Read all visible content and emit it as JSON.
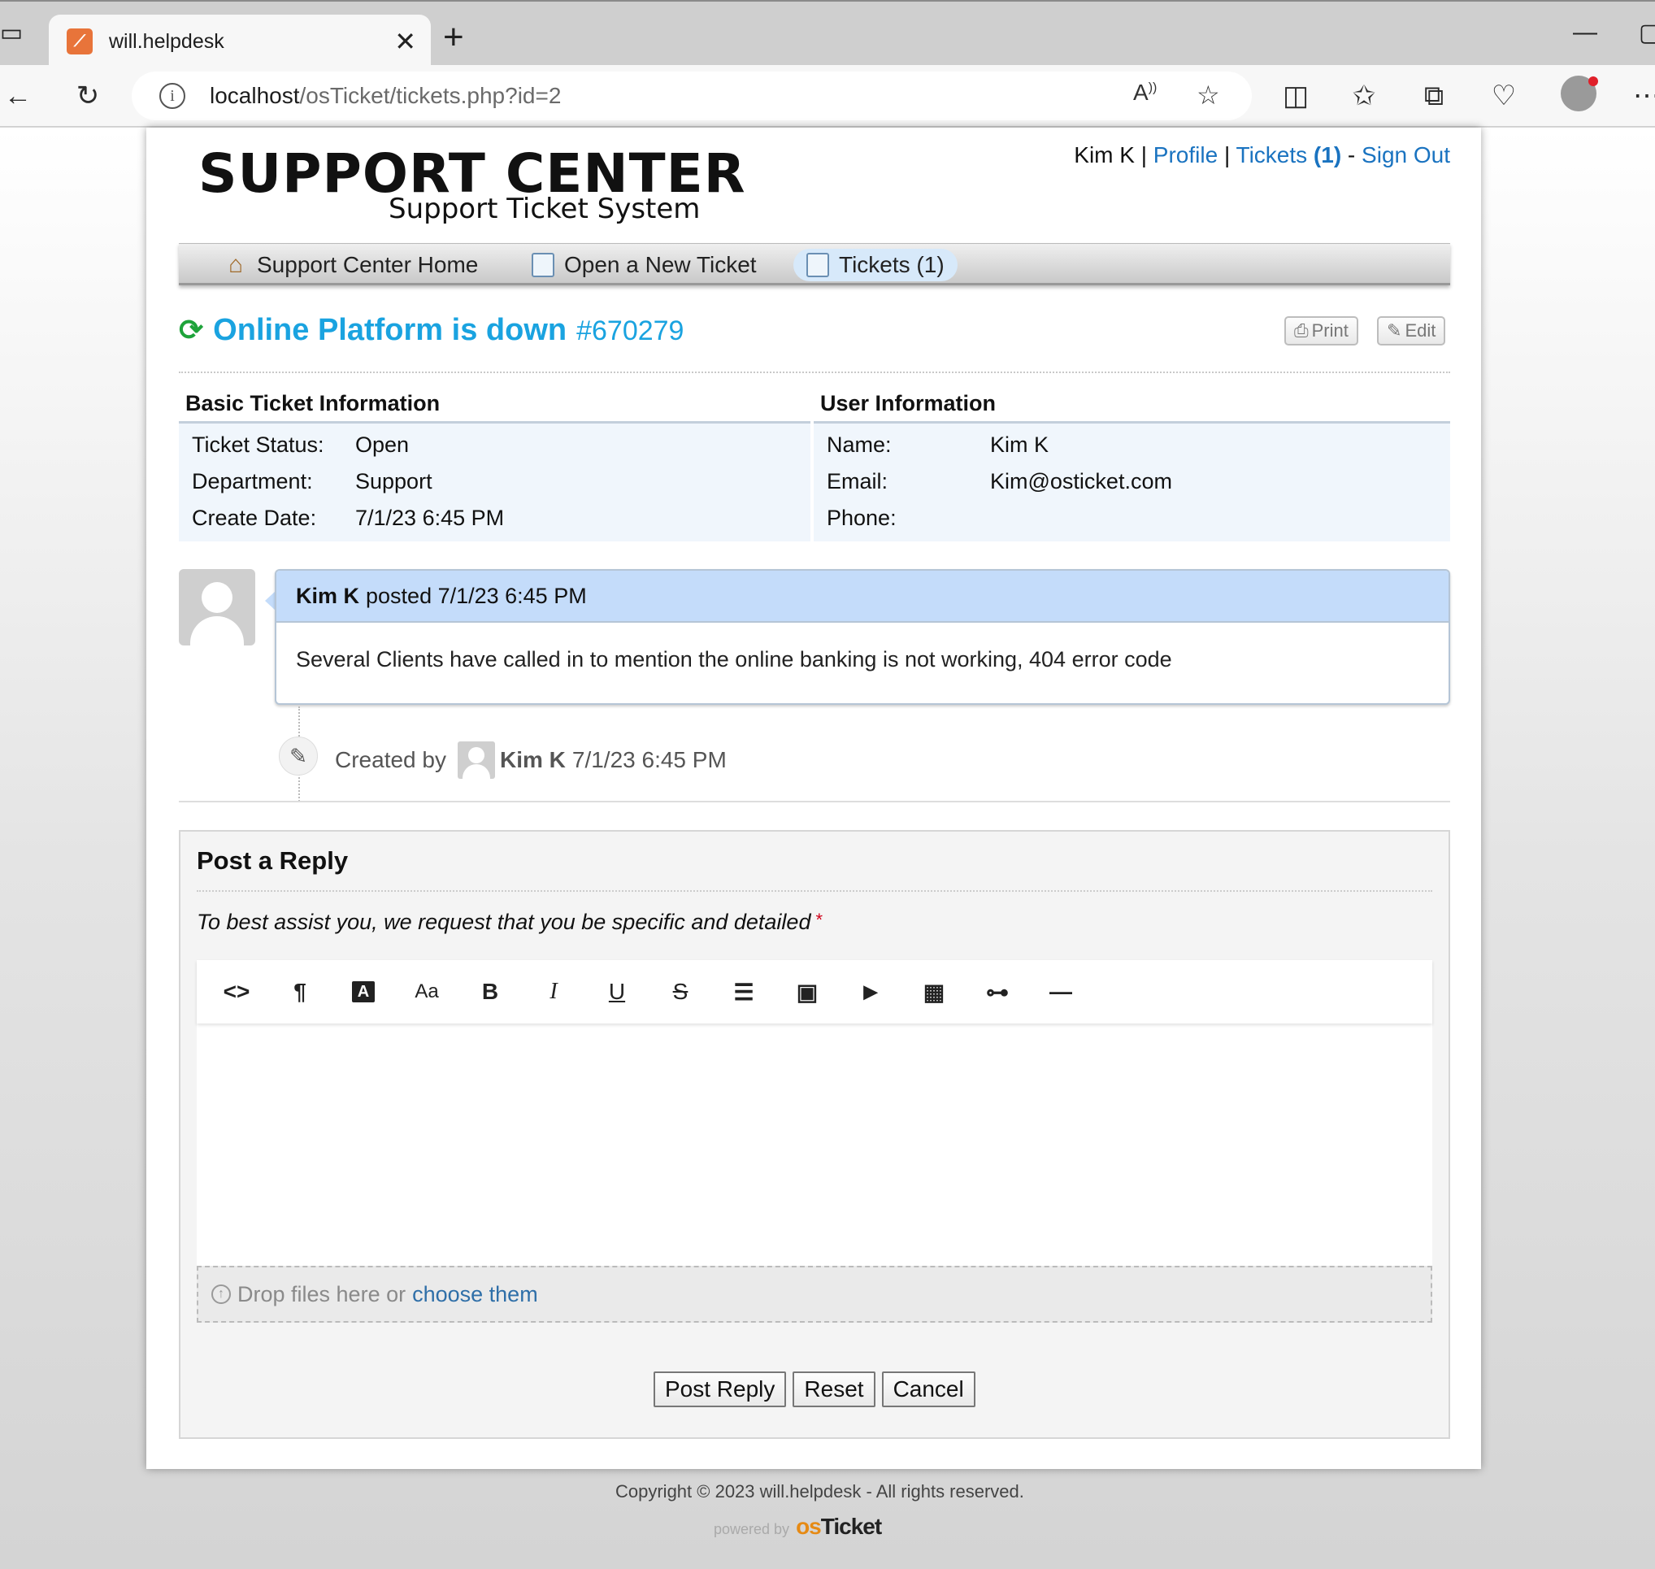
{
  "browser": {
    "tab_title": "will.helpdesk",
    "url_host": "localhost",
    "url_path": "/osTicket/tickets.php?id=2"
  },
  "header": {
    "logo_title": "SUPPORT CENTER",
    "logo_subtitle": "Support Ticket System",
    "user_name": "Kim K",
    "sep1": " | ",
    "profile_link": "Profile",
    "sep2": " | ",
    "tickets_link": "Tickets",
    "tickets_count": "(1)",
    "sep3": " - ",
    "signout_link": "Sign Out"
  },
  "nav": {
    "items": [
      {
        "label": "Support Center Home",
        "icon": "home-icon"
      },
      {
        "label": "Open a New Ticket",
        "icon": "new-ticket-icon"
      },
      {
        "label": "Tickets (1)",
        "icon": "tickets-icon",
        "active": true
      }
    ]
  },
  "ticket": {
    "subject": "Online Platform is down",
    "number": "#670279",
    "print_label": "Print",
    "edit_label": "Edit"
  },
  "basic_info": {
    "heading": "Basic Ticket Information",
    "rows": [
      {
        "label": "Ticket Status:",
        "value": "Open"
      },
      {
        "label": "Department:",
        "value": "Support"
      },
      {
        "label": "Create Date:",
        "value": "7/1/23 6:45 PM"
      }
    ]
  },
  "user_info": {
    "heading": "User Information",
    "rows": [
      {
        "label": "Name:",
        "value": "Kim K"
      },
      {
        "label": "Email:",
        "value": "Kim@osticket.com"
      },
      {
        "label": "Phone:",
        "value": ""
      }
    ]
  },
  "thread": {
    "author": "Kim K",
    "posted_text": "posted 7/1/23 6:45 PM",
    "body": "Several Clients have called in to mention the online banking is not working, 404 error code",
    "event_prefix": "Created by",
    "event_author": "Kim K",
    "event_time": "7/1/23 6:45 PM"
  },
  "reply": {
    "title": "Post a Reply",
    "instruction": "To best assist you, we request that you be specific and detailed",
    "required_mark": "*",
    "toolbar": [
      {
        "label": "<>",
        "name": "html-icon"
      },
      {
        "label": "¶",
        "name": "paragraph-icon"
      },
      {
        "label": "A",
        "name": "font-color-icon"
      },
      {
        "label": "Aa",
        "name": "font-size-icon"
      },
      {
        "label": "B",
        "name": "bold-icon"
      },
      {
        "label": "I",
        "name": "italic-icon"
      },
      {
        "label": "U",
        "name": "underline-icon"
      },
      {
        "label": "S",
        "name": "strikethrough-icon"
      },
      {
        "label": "☰",
        "name": "list-icon"
      },
      {
        "label": "▣",
        "name": "image-icon"
      },
      {
        "label": "▶",
        "name": "video-icon"
      },
      {
        "label": "▦",
        "name": "table-icon"
      },
      {
        "label": "⊶",
        "name": "link-icon"
      },
      {
        "label": "—",
        "name": "horizontal-rule-icon"
      }
    ],
    "drop_text": "Drop files here or",
    "choose_link": "choose them",
    "buttons": {
      "post": "Post Reply",
      "reset": "Reset",
      "cancel": "Cancel"
    }
  },
  "footer": {
    "copyright": "Copyright © 2023 will.helpdesk - All rights reserved.",
    "powered_by": "powered by",
    "brand_os": "os",
    "brand_ticket": "Ticket"
  }
}
